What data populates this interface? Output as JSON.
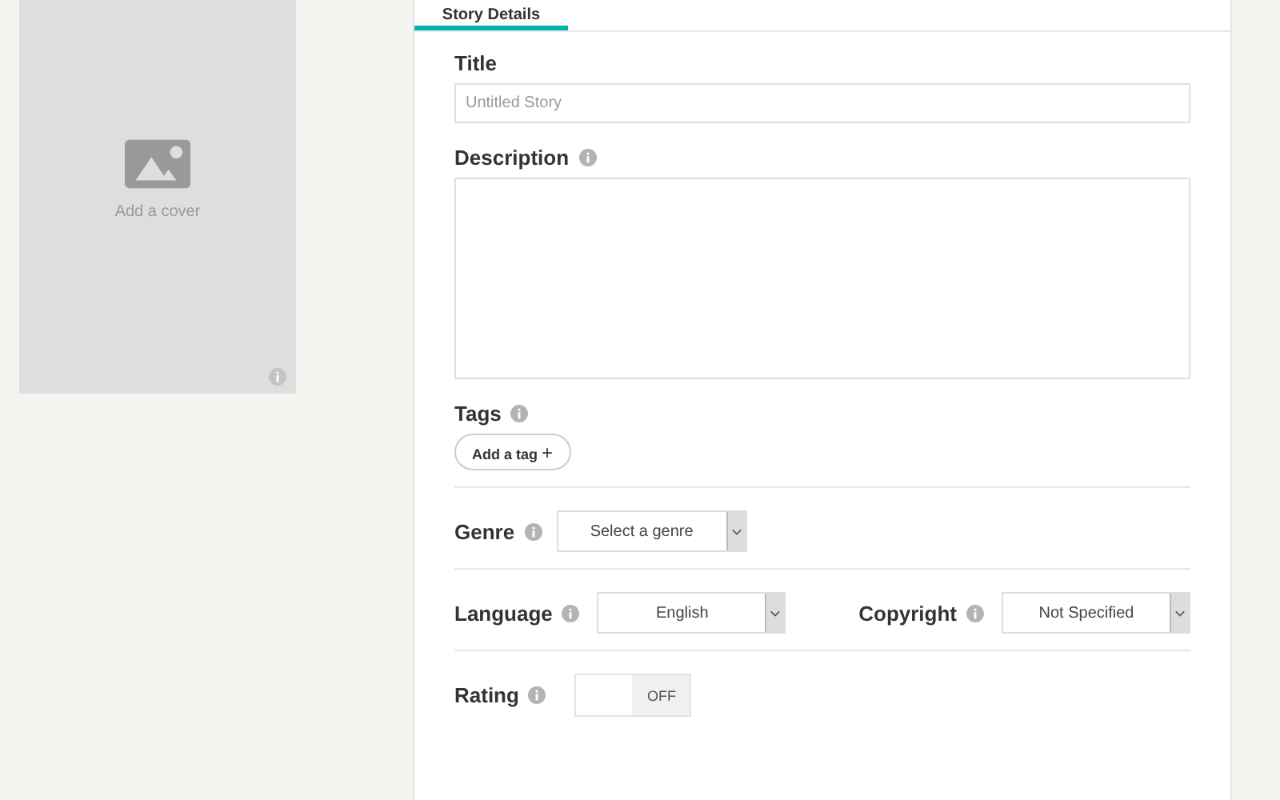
{
  "cover": {
    "label": "Add a cover"
  },
  "tabs": [
    {
      "label": "Story Details",
      "selected": true
    }
  ],
  "title": {
    "label": "Title",
    "placeholder": "Untitled Story"
  },
  "description": {
    "label": "Description"
  },
  "tags": {
    "label": "Tags",
    "button": "Add a tag",
    "button_icon": "+"
  },
  "genre": {
    "label": "Genre",
    "value": "Select a genre"
  },
  "language": {
    "label": "Language",
    "value": "English"
  },
  "copyright": {
    "label": "Copyright",
    "value": "Not Specified"
  },
  "rating": {
    "label": "Rating",
    "toggle_text": "OFF",
    "on": false
  }
}
